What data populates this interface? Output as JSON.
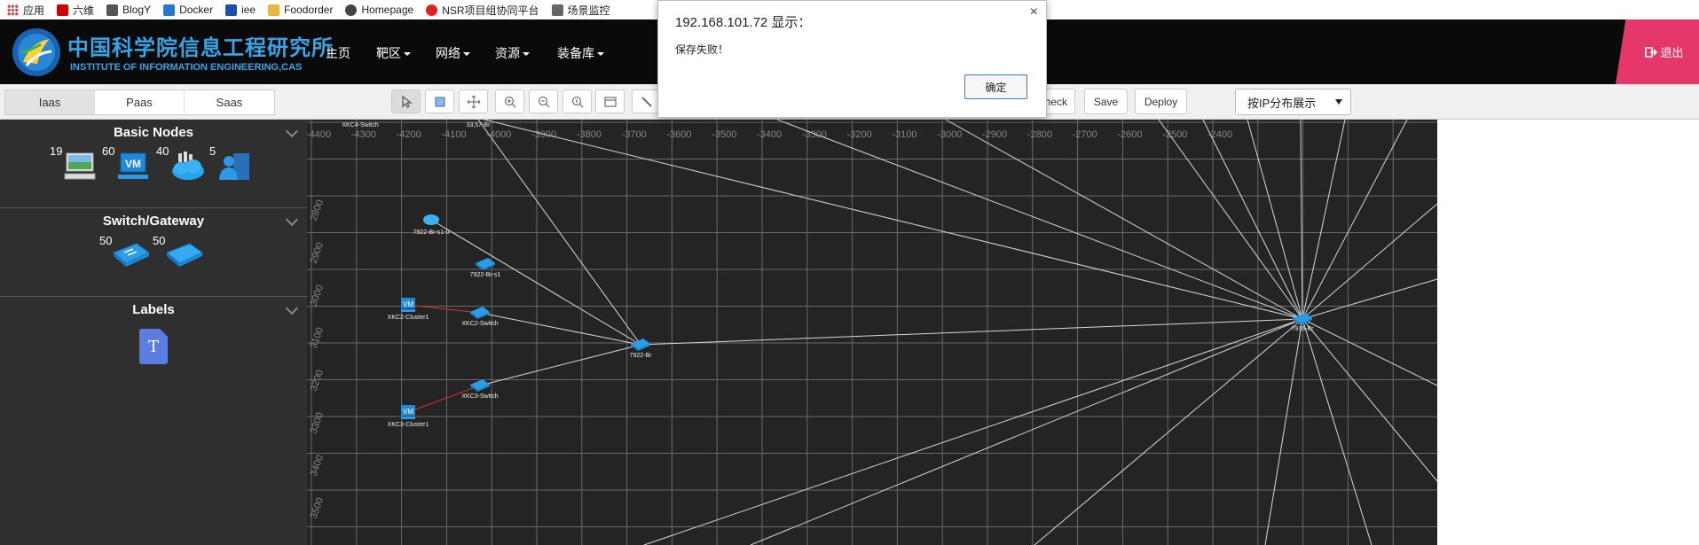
{
  "bookmarks": [
    {
      "label": "应用",
      "icon": "apps-grid-icon",
      "color": "#d44"
    },
    {
      "label": "六维",
      "icon": "sixv-icon",
      "color": "#c00"
    },
    {
      "label": "BlogY",
      "icon": "blog-icon",
      "color": "#555"
    },
    {
      "label": "Docker",
      "icon": "docker-icon",
      "color": "#2a78c8"
    },
    {
      "label": "iee",
      "icon": "mail-icon",
      "color": "#1c4fa8"
    },
    {
      "label": "Foodorder",
      "icon": "folder-icon",
      "color": "#e6b740"
    },
    {
      "label": "Homepage",
      "icon": "person-icon",
      "color": "#444"
    },
    {
      "label": "NSR项目组协同平台",
      "icon": "nsr-icon",
      "color": "#d22"
    },
    {
      "label": "场景监控",
      "icon": "page-icon",
      "color": "#666"
    }
  ],
  "header": {
    "logo_cn": "中国科学院信息工程研究所",
    "logo_en": "INSTITUTE OF INFORMATION ENGINEERING,CAS",
    "nav": [
      "主页",
      "靶区",
      "网络",
      "资源",
      "装备库"
    ],
    "logout": "退出",
    "accent": "#e5376a"
  },
  "toolbar": {
    "tabs": [
      "Iaas",
      "Paas",
      "Saas"
    ],
    "active_tab": "Iaas",
    "check": "Check",
    "save": "Save",
    "deploy": "Deploy",
    "layout_select": "按IP分布展示"
  },
  "sidebar": {
    "basic_title": "Basic Nodes",
    "basic_counts": [
      "19",
      "60",
      "40",
      "5"
    ],
    "switch_title": "Switch/Gateway",
    "switch_counts": [
      "50",
      "50"
    ],
    "labels_title": "Labels",
    "label_glyph": "T"
  },
  "canvas": {
    "x_ticks": [
      "-4400",
      "-4300",
      "-4200",
      "-4100",
      "-4000",
      "-3900",
      "-3800",
      "-3700",
      "-3600",
      "-3500",
      "-3400",
      "-3300",
      "-3200",
      "-3100",
      "-3000",
      "-2900",
      "-2800",
      "-2700",
      "-2600",
      "-2500",
      "-2400"
    ],
    "y_ticks": [
      "2800",
      "2900",
      "3000",
      "3100",
      "3200",
      "3300",
      "3400",
      "3500"
    ],
    "nodes": {
      "xkc4": "XKC4-Switch",
      "n33": "33,57-Br",
      "n7922_r_s1_0": "7922-Br-s1-0",
      "n7922_r_s1": "7922-Br-s1",
      "xkc2_cluster": "XKC2-Cluster1",
      "xkc2_switch": "XKC2-Switch",
      "n7922_r": "7922-Br",
      "xkc3_switch": "XKC3-Switch",
      "xkc3_cluster": "XKC3-Cluster1",
      "hub": "7916-Br"
    }
  },
  "dialog": {
    "title": "192.168.101.72 显示：",
    "message": "保存失败！",
    "ok": "确定",
    "close": "×"
  }
}
